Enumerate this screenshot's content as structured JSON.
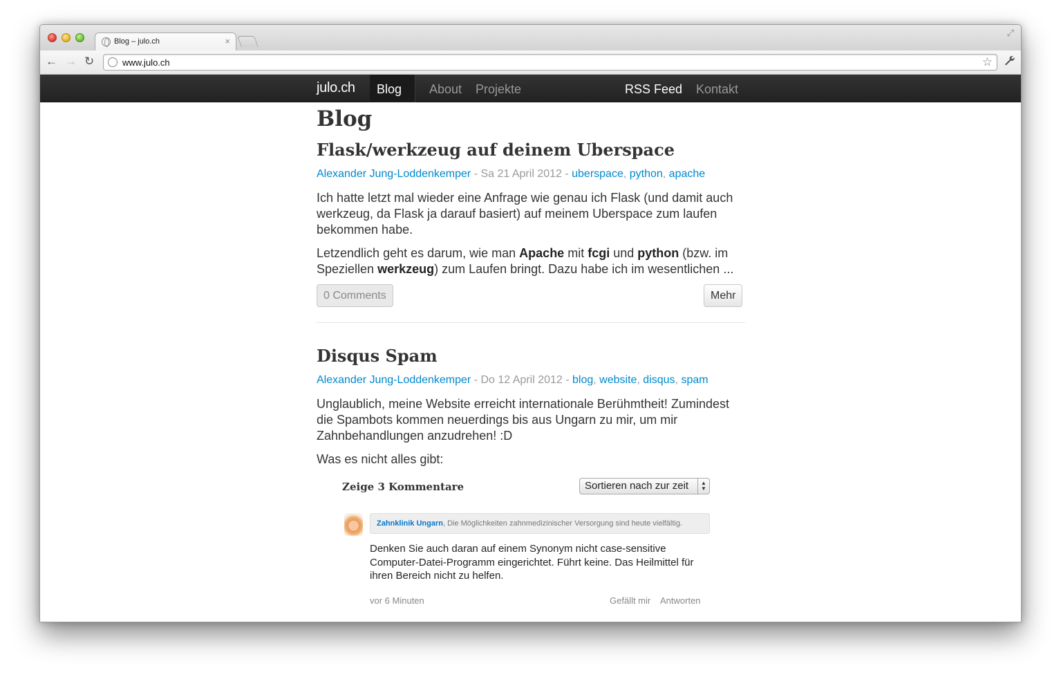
{
  "browser": {
    "tab_title": "Blog – julo.ch",
    "tab_close": "×",
    "url": "www.julo.ch",
    "back_glyph": "←",
    "forward_glyph": "→",
    "reload_glyph": "↻",
    "star_glyph": "☆",
    "wrench_glyph": "🔧",
    "fullscreen_glyph": "⤢"
  },
  "navbar": {
    "brand": "julo.ch",
    "links": [
      {
        "label": "Blog",
        "active": true
      },
      {
        "label": "About",
        "active": false
      },
      {
        "label": "Projekte",
        "active": false
      },
      {
        "label": "RSS Feed",
        "active": true
      },
      {
        "label": "Kontakt",
        "active": false
      }
    ]
  },
  "page": {
    "heading": "Blog"
  },
  "posts": [
    {
      "title": "Flask/werkzeug auf deinem Uberspace",
      "author": "Alexander Jung-Loddenkemper",
      "date_sep": " - ",
      "date": "Sa 21 April 2012",
      "tags_sep": " - ",
      "tags": [
        "uberspace",
        "python",
        "apache"
      ],
      "paragraph1": "Ich hatte letzt mal wieder eine Anfrage wie genau ich Flask (und damit auch werkzeug, da Flask ja darauf basiert) auf meinem Uberspace zum laufen bekommen habe.",
      "p2_a": "Letzendlich geht es darum, wie man ",
      "p2_b": "Apache",
      "p2_c": " mit ",
      "p2_d": "fcgi",
      "p2_e": " und ",
      "p2_f": "python",
      "p2_g": " (bzw. im Speziellen ",
      "p2_h": "werkzeug",
      "p2_i": ") zum Laufen bringt. Dazu habe ich im wesentlichen ...",
      "comments_button": "0 Comments",
      "more_button": "Mehr"
    },
    {
      "title": "Disqus Spam",
      "author": "Alexander Jung-Loddenkemper",
      "date_sep": " - ",
      "date": "Do 12 April 2012",
      "tags_sep": " - ",
      "tags": [
        "blog",
        "website",
        "disqus",
        "spam"
      ],
      "paragraph1": "Unglaublich, meine Website erreicht internationale Berühmtheit! Zumindest die Spambots kommen neuerdings bis aus Ungarn zu mir, um mir Zahnbehandlungen anzudrehen! :D",
      "paragraph2": "Was es nicht alles gibt:"
    }
  ],
  "disqus": {
    "header": "Zeige 3 Kommentare",
    "sort_selected": "Sortieren nach zur zeit",
    "comment": {
      "author": "Zahnklinik Ungarn",
      "author_tagline": ", Die Möglichkeiten zahnmedizinischer Versorgung sind heute vielfältig.",
      "body": "Denken Sie auch daran auf einem Synonym nicht case-sensitive Computer-Datei-Programm eingerichtet. Führt keine. Das Heilmittel für ihren Bereich nicht zu helfen.",
      "time": "vor 6 Minuten",
      "like": "Gefällt mir",
      "reply": "Antworten"
    }
  },
  "colors": {
    "link": "#0088cc",
    "navbar": "#222222",
    "text": "#333333"
  }
}
